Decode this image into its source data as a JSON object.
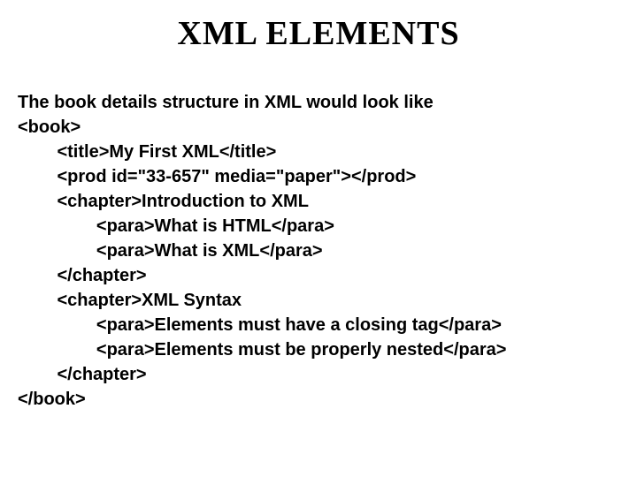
{
  "title": "XML ELEMENTS",
  "intro": "The book details structure in XML would look like",
  "lines": {
    "l0": "<book>",
    "l1": "        <title>My First XML</title>",
    "l2": "        <prod id=\"33-657\" media=\"paper\"></prod>",
    "l3": "        <chapter>Introduction to XML",
    "l4": "                <para>What is HTML</para>",
    "l5": "                <para>What is XML</para>",
    "l6": "        </chapter>",
    "l7": "        <chapter>XML Syntax",
    "l8": "                <para>Elements must have a closing tag</para>",
    "l9": "                <para>Elements must be properly nested</para>",
    "l10": "        </chapter>",
    "l11": "</book>"
  }
}
